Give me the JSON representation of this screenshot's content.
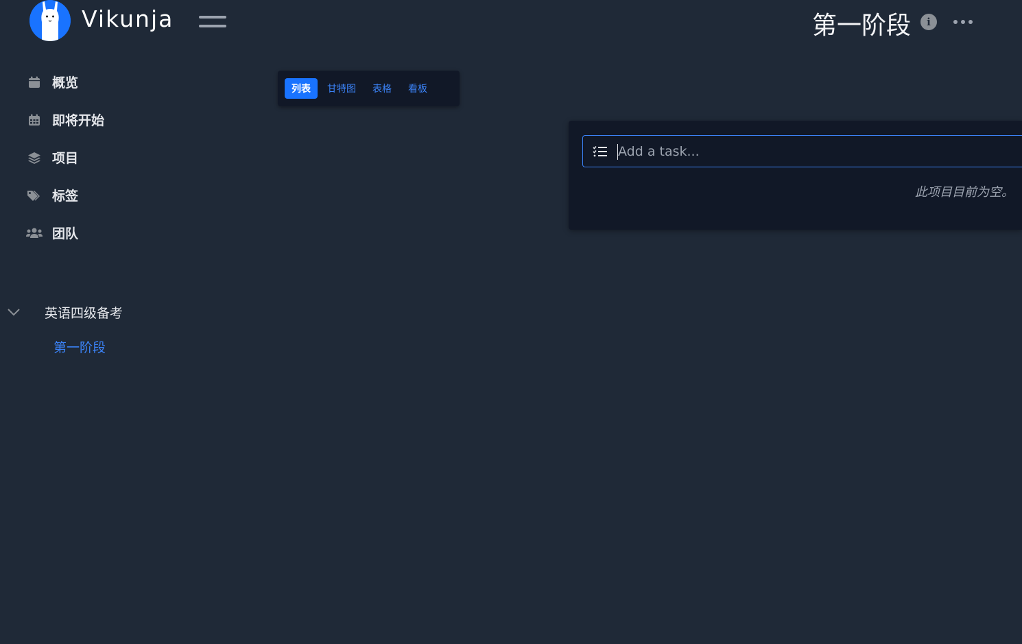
{
  "app": {
    "name": "Vikunja"
  },
  "header": {
    "project_title": "第一阶段",
    "info_icon": "i"
  },
  "sidebar": {
    "items": [
      {
        "icon": "calendar-icon",
        "label": "概览"
      },
      {
        "icon": "calendar-grid-icon",
        "label": "即将开始"
      },
      {
        "icon": "layers-icon",
        "label": "项目"
      },
      {
        "icon": "tags-icon",
        "label": "标签"
      },
      {
        "icon": "users-icon",
        "label": "团队"
      }
    ],
    "projects": {
      "parent": "英语四级备考",
      "child": "第一阶段"
    }
  },
  "views": {
    "tabs": [
      {
        "label": "列表",
        "active": true
      },
      {
        "label": "甘特图",
        "active": false
      },
      {
        "label": "表格",
        "active": false
      },
      {
        "label": "看板",
        "active": false
      }
    ]
  },
  "task_panel": {
    "add_task_placeholder": "Add a task...",
    "empty_message": "此项目目前为空。"
  },
  "colors": {
    "background": "#1f2937",
    "card": "#111827",
    "accent": "#1973ff",
    "link": "#3b82f6",
    "muted": "#9ca3af"
  }
}
